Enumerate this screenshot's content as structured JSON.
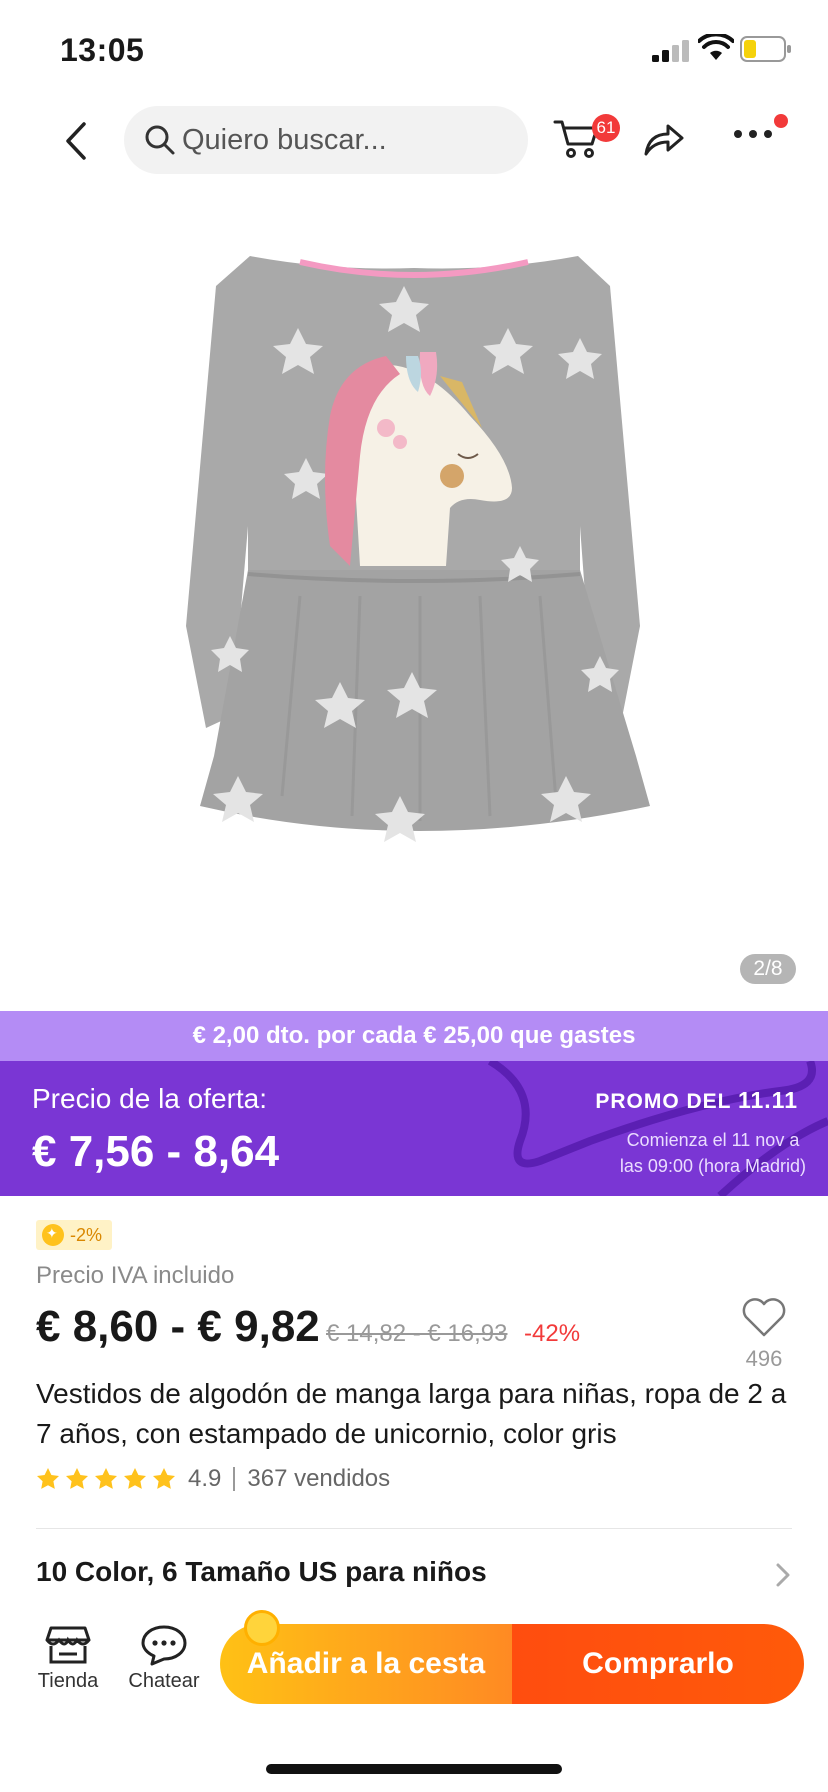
{
  "status": {
    "time": "13:05"
  },
  "header": {
    "search_placeholder": "Quiero buscar...",
    "cart_count": "61"
  },
  "gallery": {
    "counter": "2/8"
  },
  "promo": {
    "banner": "€ 2,00 dto. por cada € 25,00 que gastes",
    "offer_label": "Precio de la oferta:",
    "offer_price": "€ 7,56 - 8,64",
    "event_title": "PROMO DEL",
    "event_number": "11.11",
    "event_start_line1": "Comienza el 11 nov a",
    "event_start_line2": "las 09:00 (hora Madrid)",
    "accent_color": "#7a36d4"
  },
  "product": {
    "coin_discount": "-2%",
    "tax_note": "Precio IVA incluido",
    "price": "€ 8,60 - € 9,82",
    "old_price": "€ 14,82 - € 16,93",
    "discount": "-42%",
    "wishlist_count": "496",
    "title": "Vestidos de algodón de manga larga para niñas, ropa de 2 a 7 años, con estampado de unicornio, color gris",
    "rating": "4.9",
    "stars": 5,
    "sold": "367 vendidos",
    "variants": "10 Color, 6 Tamaño US para niños"
  },
  "bottom": {
    "store_label": "Tienda",
    "chat_label": "Chatear",
    "add_to_cart": "Añadir a la cesta",
    "buy_now": "Comprarlo"
  }
}
